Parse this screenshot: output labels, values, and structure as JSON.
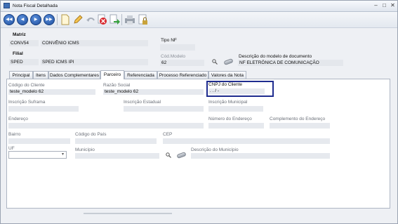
{
  "window": {
    "title": "Nota Fiscal Detalhada",
    "min_glyph": "–",
    "max_glyph": "□",
    "close_glyph": "✕"
  },
  "toolbar": {
    "first_glyph": "◀◀",
    "prev_glyph": "◀",
    "next_glyph": "▶",
    "last_glyph": "▶▶"
  },
  "header": {
    "matriz_label": "Matriz",
    "matriz_code": "CONV54",
    "matriz_name": "CONVÊNIO ICMS",
    "tipo_nf_label": "Tipo NF",
    "tipo_nf_value": "",
    "filial_label": "Filial",
    "filial_code": "SPED",
    "filial_name": "SPED ICMS IPI",
    "cod_modelo_label": "Cód.Modelo",
    "cod_modelo_value": "62",
    "descricao_modelo_label": "Descrição do modelo de documento",
    "descricao_modelo_value": "NF ELETRÔNICA DE COMUNICAÇÃO"
  },
  "tabs": [
    {
      "label": "Principal"
    },
    {
      "label": "Itens"
    },
    {
      "label": "Dados Complementares"
    },
    {
      "label": "Parceiro",
      "active": true
    },
    {
      "label": "Referenciada"
    },
    {
      "label": "Processo Referenciado"
    },
    {
      "label": "Valores da Nota"
    }
  ],
  "parceiro": {
    "codigo_cliente_label": "Código do Cliente",
    "codigo_cliente_value": "teste_modelo 62",
    "razao_social_label": "Razão Social",
    "razao_social_value": "teste_modelo 62",
    "cnpj_label": "CNPJ do Cliente",
    "cnpj_value": " .  .  /   -",
    "inscricao_suframa_label": "Inscrição Suframa",
    "inscricao_suframa_value": "",
    "inscricao_estadual_label": "Inscrição Estadual",
    "inscricao_estadual_value": "",
    "inscricao_municipal_label": "Inscrição Municipal",
    "inscricao_municipal_value": "",
    "endereco_label": "Endereço",
    "endereco_value": "",
    "numero_endereco_label": "Número do Endereço",
    "numero_endereco_value": "",
    "complemento_label": "Complemento do Endereço",
    "complemento_value": "",
    "bairro_label": "Bairro",
    "bairro_value": "",
    "codigo_pais_label": "Código do País",
    "codigo_pais_value": "",
    "cep_label": "CEP",
    "cep_value": "",
    "uf_label": "UF",
    "uf_value": "",
    "municipio_label": "Município",
    "municipio_value": "",
    "descricao_municipio_label": "Descrição do Município",
    "descricao_municipio_value": ""
  },
  "colors": {
    "highlight_border": "#1f2c8f",
    "field_bg": "#e6e9ee",
    "tab_border": "#aeb6c3"
  },
  "icons": [
    "app-icon",
    "first-record-icon",
    "prev-record-icon",
    "next-record-icon",
    "last-record-icon",
    "new-document-icon",
    "edit-pencil-icon",
    "undo-icon",
    "delete-icon",
    "save-arrow-icon",
    "printer-icon",
    "lock-icon",
    "search-icon",
    "eraser-icon",
    "chevron-down-icon"
  ]
}
